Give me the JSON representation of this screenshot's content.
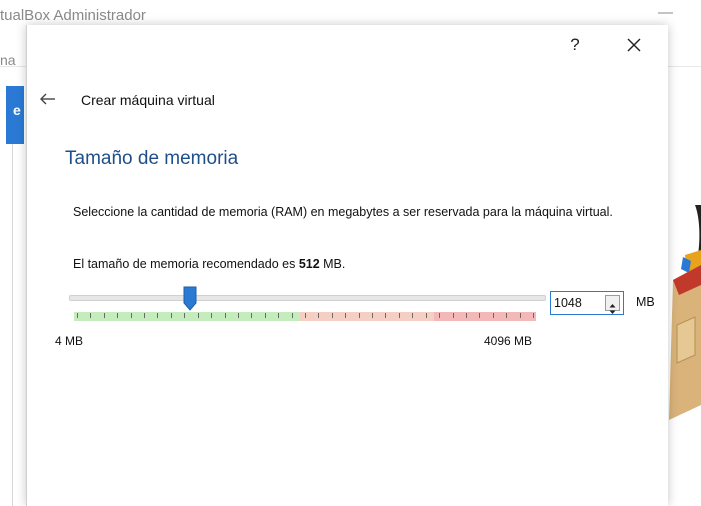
{
  "background": {
    "window_title": "tualBox Administrador",
    "menu_fragment": "na",
    "sidebar_fragment": "e"
  },
  "dialog": {
    "help_label": "?",
    "header_title": "Crear máquina virtual",
    "page_title": "Tamaño de memoria",
    "description": "Seleccione la cantidad de memoria (RAM) en megabytes a ser reservada para la máquina virtual.",
    "recommended_prefix": "El tamaño de memoria recomendado es ",
    "recommended_value": "512",
    "recommended_suffix": " MB.",
    "memory": {
      "value": "1048",
      "unit": "MB",
      "min_label": "4 MB",
      "max_label": "4096 MB",
      "slider_fraction": 0.255
    }
  },
  "colors": {
    "accent": "#2a7ad5",
    "title_blue": "#1f4f8a",
    "scale_green": "#c5ecbc",
    "scale_orange": "#f6cfc4",
    "scale_red": "#f3b9b9"
  },
  "icons": {
    "back": "arrow-left-icon",
    "close": "close-icon",
    "spin_up": "triangle-up-icon",
    "spin_down": "triangle-down-icon"
  }
}
